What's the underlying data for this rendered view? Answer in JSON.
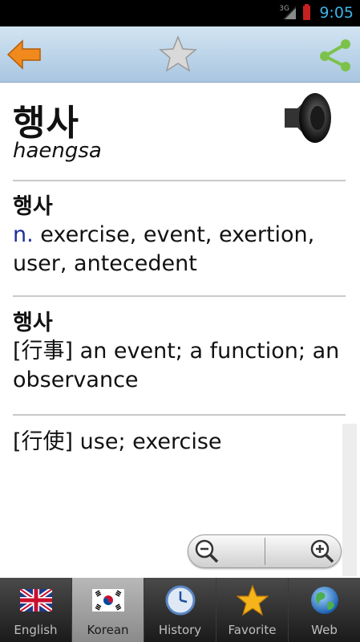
{
  "status_bar": {
    "network": "3G",
    "time": "9:05",
    "icons": [
      "signal-icon",
      "battery-icon"
    ]
  },
  "toolbar": {
    "back_icon": "back-arrow-icon",
    "favorite_icon": "star-icon",
    "share_icon": "share-icon"
  },
  "word": {
    "headword": "행사",
    "romanization": "haengsa",
    "audio_icon": "speaker-icon"
  },
  "entries": [
    {
      "headword": "행사",
      "pos": "n.",
      "definition": " exercise, event, exertion, user, antecedent"
    },
    {
      "headword": "행사",
      "definition": "[行事] an event; a function; an observance"
    },
    {
      "definition": "[行使] use; exercise"
    }
  ],
  "zoom": {
    "out_icon": "zoom-out-icon",
    "in_icon": "zoom-in-icon"
  },
  "tabs": [
    {
      "label": "English",
      "icon": "uk-flag-icon"
    },
    {
      "label": "Korean",
      "icon": "korea-flag-icon",
      "active": true
    },
    {
      "label": "History",
      "icon": "clock-icon"
    },
    {
      "label": "Favorite",
      "icon": "star-icon"
    },
    {
      "label": "Web",
      "icon": "globe-icon"
    }
  ],
  "colors": {
    "toolbar": "#b9d2e8",
    "accent_clock": "#3fb3e6",
    "pos_label": "#1f2f9a",
    "back_arrow": "#f08a1c",
    "share": "#7cc24a"
  }
}
